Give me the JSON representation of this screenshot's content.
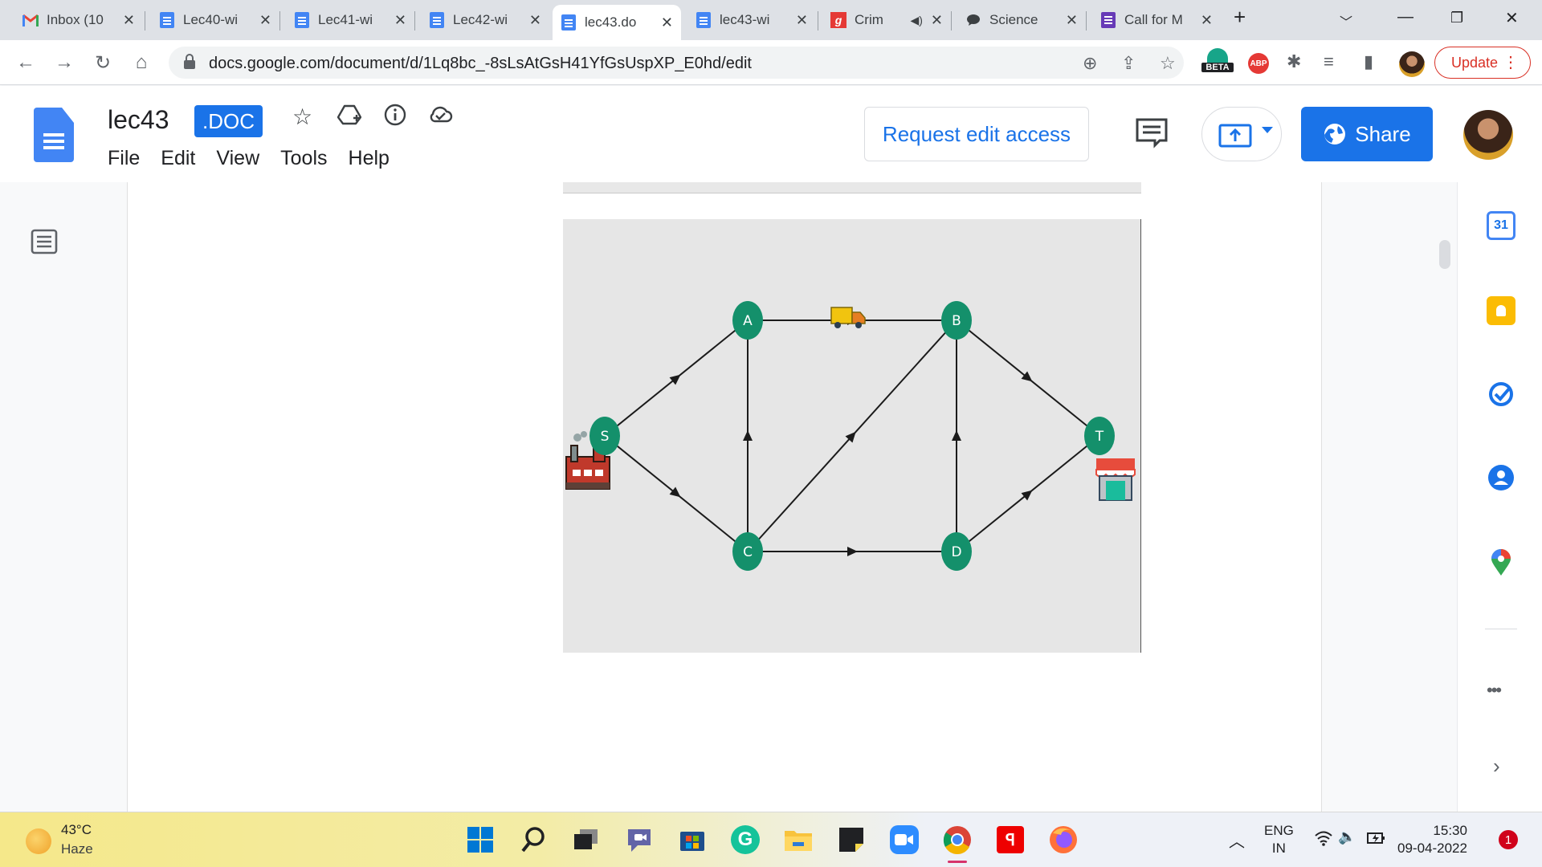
{
  "browser": {
    "tabs": [
      {
        "title": "Inbox (10",
        "favicon": "gmail-icon"
      },
      {
        "title": "Lec40-wi",
        "favicon": "google-docs-icon"
      },
      {
        "title": "Lec41-wi",
        "favicon": "google-docs-icon"
      },
      {
        "title": "Lec42-wi",
        "favicon": "google-docs-icon"
      },
      {
        "title": "lec43.do",
        "favicon": "google-docs-icon",
        "active": true
      },
      {
        "title": "lec43-wi",
        "favicon": "google-docs-icon"
      },
      {
        "title": "Crim",
        "favicon": "g-site-icon",
        "audio": true
      },
      {
        "title": "Science",
        "favicon": "chat-bubble-icon"
      },
      {
        "title": "Call for M",
        "favicon": "google-forms-icon"
      }
    ],
    "url": "docs.google.com/document/d/1Lq8bc_-8sLsAtGsH41YfGsUspXP_E0hd/edit",
    "extension_beta_label": "BETA",
    "adblock_label": "ABP",
    "update_label": "Update"
  },
  "docs": {
    "title": "lec43",
    "format_badge": ".DOC",
    "menu": [
      "File",
      "Edit",
      "View",
      "Tools",
      "Help"
    ],
    "request_access_label": "Request edit access",
    "share_label": "Share"
  },
  "diagram": {
    "nodes": [
      "A",
      "B",
      "S",
      "T",
      "C",
      "D"
    ],
    "edges": [
      [
        "S",
        "A"
      ],
      [
        "S",
        "C"
      ],
      [
        "C",
        "A"
      ],
      [
        "A",
        "B"
      ],
      [
        "C",
        "B"
      ],
      [
        "C",
        "D"
      ],
      [
        "D",
        "B"
      ],
      [
        "B",
        "T"
      ],
      [
        "D",
        "T"
      ]
    ],
    "source_icon": "factory-icon",
    "sink_icon": "store-icon",
    "vehicle_icon": "delivery-truck-icon",
    "node_color": "#14906b"
  },
  "side_panel": {
    "calendar_day": "31",
    "more_label": "•••"
  },
  "taskbar": {
    "temperature": "43°C",
    "weather": "Haze",
    "lang_line1": "ENG",
    "lang_line2": "IN",
    "time": "15:30",
    "date": "09-04-2022",
    "notifications": "1"
  }
}
